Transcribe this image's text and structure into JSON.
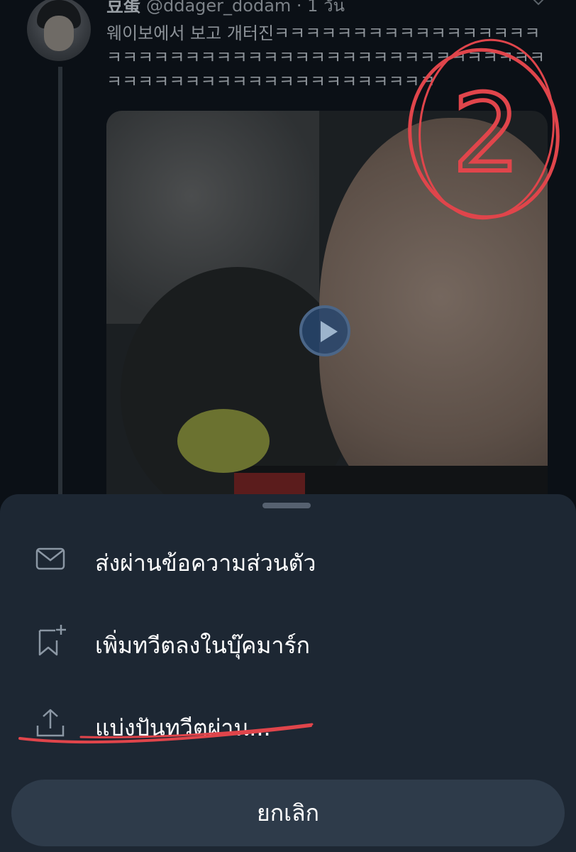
{
  "tweet": {
    "display_name": "豆蛋",
    "handle_time": "@ddager_dodam · 1 วัน",
    "text_lines": [
      "웨이보에서 보고 개터진ㅋㅋㅋㅋㅋㅋㅋㅋㅋㅋㅋㅋㅋㅋㅋㅋㅋ",
      "ㅋㅋㅋㅋㅋㅋㅋㅋㅋㅋㅋㅋㅋㅋㅋㅋㅋㅋㅋㅋㅋㅋㅋㅋㅋㅋㅋㅋ",
      "ㅋㅋㅋㅋㅋㅋㅋㅋㅋㅋㅋㅋㅋㅋㅋㅋㅋㅋㅋㅋㅋ"
    ]
  },
  "annotation": {
    "number": "2",
    "color": "#e0454b"
  },
  "sheet": {
    "items": [
      {
        "label": "ส่งผ่านข้อความส่วนตัว",
        "icon": "mail-icon"
      },
      {
        "label": "เพิ่มทวีตลงในบุ๊คมาร์ก",
        "icon": "bookmark-add-icon"
      },
      {
        "label": "แบ่งปันทวีตผ่าน...",
        "icon": "share-icon"
      }
    ],
    "cancel_label": "ยกเลิก"
  },
  "colors": {
    "background": "#0b1016",
    "sheet": "#1d2733",
    "cancel_button": "#2e3b4a",
    "annotation_red": "#e0454b"
  }
}
